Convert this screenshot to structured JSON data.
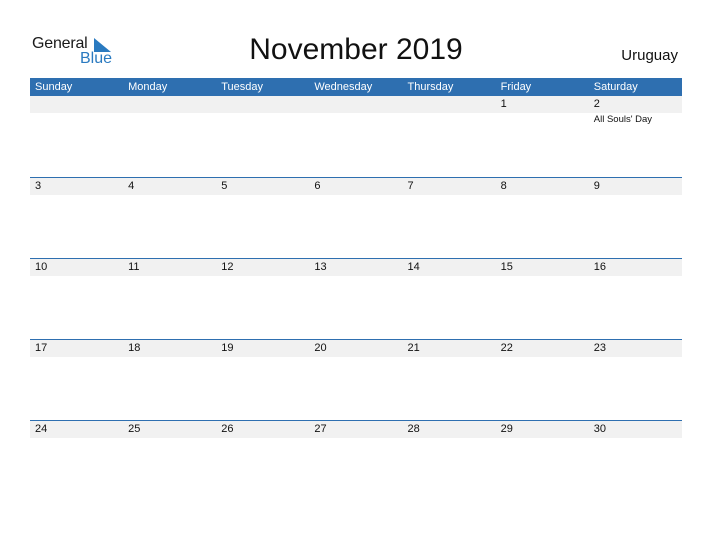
{
  "logo": {
    "general": "General",
    "blue": "Blue"
  },
  "title": "November 2019",
  "country": "Uruguay",
  "weekdays": [
    "Sunday",
    "Monday",
    "Tuesday",
    "Wednesday",
    "Thursday",
    "Friday",
    "Saturday"
  ],
  "weeks": [
    [
      {
        "day": ""
      },
      {
        "day": ""
      },
      {
        "day": ""
      },
      {
        "day": ""
      },
      {
        "day": ""
      },
      {
        "day": "1"
      },
      {
        "day": "2",
        "holiday": "All Souls' Day"
      }
    ],
    [
      {
        "day": "3"
      },
      {
        "day": "4"
      },
      {
        "day": "5"
      },
      {
        "day": "6"
      },
      {
        "day": "7"
      },
      {
        "day": "8"
      },
      {
        "day": "9"
      }
    ],
    [
      {
        "day": "10"
      },
      {
        "day": "11"
      },
      {
        "day": "12"
      },
      {
        "day": "13"
      },
      {
        "day": "14"
      },
      {
        "day": "15"
      },
      {
        "day": "16"
      }
    ],
    [
      {
        "day": "17"
      },
      {
        "day": "18"
      },
      {
        "day": "19"
      },
      {
        "day": "20"
      },
      {
        "day": "21"
      },
      {
        "day": "22"
      },
      {
        "day": "23"
      }
    ],
    [
      {
        "day": "24"
      },
      {
        "day": "25"
      },
      {
        "day": "26"
      },
      {
        "day": "27"
      },
      {
        "day": "28"
      },
      {
        "day": "29"
      },
      {
        "day": "30"
      }
    ]
  ],
  "colors": {
    "header": "#2e6fb0",
    "strip": "#f1f1f1",
    "brand": "#2a7ac0"
  }
}
